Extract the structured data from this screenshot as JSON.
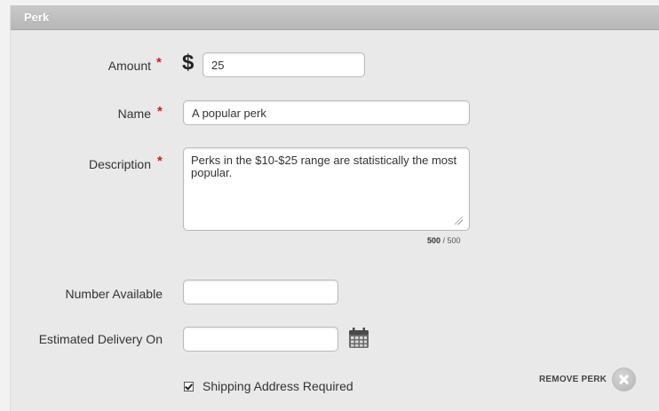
{
  "panel": {
    "title": "Perk"
  },
  "form": {
    "amount": {
      "label": "Amount",
      "required_mark": "*",
      "currency_symbol": "$",
      "value": "25"
    },
    "name": {
      "label": "Name",
      "required_mark": "*",
      "value": "A popular perk"
    },
    "description": {
      "label": "Description",
      "required_mark": "*",
      "value": "Perks in the $10-$25 range are statistically the most popular.",
      "counter_current": "500",
      "counter_separator": " / ",
      "counter_max": "500"
    },
    "number_available": {
      "label": "Number Available",
      "value": ""
    },
    "estimated_delivery": {
      "label": "Estimated Delivery On",
      "value": "",
      "icon": "calendar-icon"
    },
    "shipping": {
      "label": "Shipping Address Required",
      "checked": true
    }
  },
  "actions": {
    "remove_perk_label": "REMOVE PERK",
    "remove_icon": "close-circle-icon"
  },
  "colors": {
    "required": "#d01b1b",
    "header": "#bcbcbc",
    "panel_bg": "#e9e9e9"
  }
}
